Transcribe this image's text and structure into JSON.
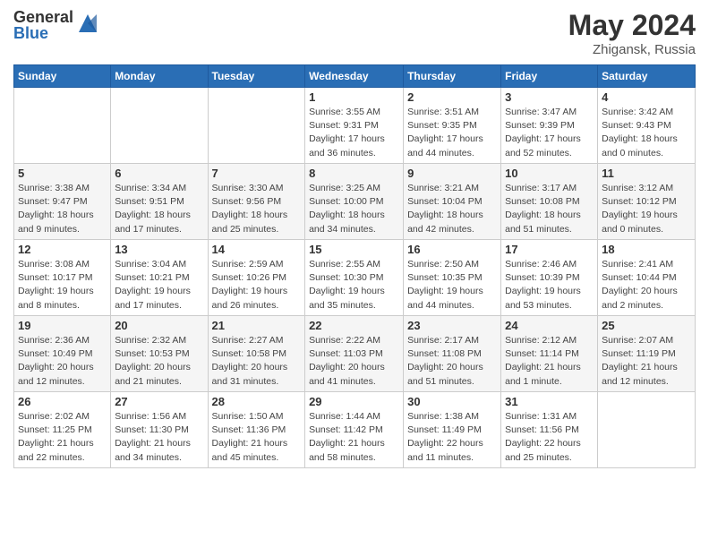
{
  "logo": {
    "general": "General",
    "blue": "Blue"
  },
  "header": {
    "month_year": "May 2024",
    "location": "Zhigansk, Russia"
  },
  "days_of_week": [
    "Sunday",
    "Monday",
    "Tuesday",
    "Wednesday",
    "Thursday",
    "Friday",
    "Saturday"
  ],
  "weeks": [
    [
      {
        "day": "",
        "info": ""
      },
      {
        "day": "",
        "info": ""
      },
      {
        "day": "",
        "info": ""
      },
      {
        "day": "1",
        "info": "Sunrise: 3:55 AM\nSunset: 9:31 PM\nDaylight: 17 hours\nand 36 minutes."
      },
      {
        "day": "2",
        "info": "Sunrise: 3:51 AM\nSunset: 9:35 PM\nDaylight: 17 hours\nand 44 minutes."
      },
      {
        "day": "3",
        "info": "Sunrise: 3:47 AM\nSunset: 9:39 PM\nDaylight: 17 hours\nand 52 minutes."
      },
      {
        "day": "4",
        "info": "Sunrise: 3:42 AM\nSunset: 9:43 PM\nDaylight: 18 hours\nand 0 minutes."
      }
    ],
    [
      {
        "day": "5",
        "info": "Sunrise: 3:38 AM\nSunset: 9:47 PM\nDaylight: 18 hours\nand 9 minutes."
      },
      {
        "day": "6",
        "info": "Sunrise: 3:34 AM\nSunset: 9:51 PM\nDaylight: 18 hours\nand 17 minutes."
      },
      {
        "day": "7",
        "info": "Sunrise: 3:30 AM\nSunset: 9:56 PM\nDaylight: 18 hours\nand 25 minutes."
      },
      {
        "day": "8",
        "info": "Sunrise: 3:25 AM\nSunset: 10:00 PM\nDaylight: 18 hours\nand 34 minutes."
      },
      {
        "day": "9",
        "info": "Sunrise: 3:21 AM\nSunset: 10:04 PM\nDaylight: 18 hours\nand 42 minutes."
      },
      {
        "day": "10",
        "info": "Sunrise: 3:17 AM\nSunset: 10:08 PM\nDaylight: 18 hours\nand 51 minutes."
      },
      {
        "day": "11",
        "info": "Sunrise: 3:12 AM\nSunset: 10:12 PM\nDaylight: 19 hours\nand 0 minutes."
      }
    ],
    [
      {
        "day": "12",
        "info": "Sunrise: 3:08 AM\nSunset: 10:17 PM\nDaylight: 19 hours\nand 8 minutes."
      },
      {
        "day": "13",
        "info": "Sunrise: 3:04 AM\nSunset: 10:21 PM\nDaylight: 19 hours\nand 17 minutes."
      },
      {
        "day": "14",
        "info": "Sunrise: 2:59 AM\nSunset: 10:26 PM\nDaylight: 19 hours\nand 26 minutes."
      },
      {
        "day": "15",
        "info": "Sunrise: 2:55 AM\nSunset: 10:30 PM\nDaylight: 19 hours\nand 35 minutes."
      },
      {
        "day": "16",
        "info": "Sunrise: 2:50 AM\nSunset: 10:35 PM\nDaylight: 19 hours\nand 44 minutes."
      },
      {
        "day": "17",
        "info": "Sunrise: 2:46 AM\nSunset: 10:39 PM\nDaylight: 19 hours\nand 53 minutes."
      },
      {
        "day": "18",
        "info": "Sunrise: 2:41 AM\nSunset: 10:44 PM\nDaylight: 20 hours\nand 2 minutes."
      }
    ],
    [
      {
        "day": "19",
        "info": "Sunrise: 2:36 AM\nSunset: 10:49 PM\nDaylight: 20 hours\nand 12 minutes."
      },
      {
        "day": "20",
        "info": "Sunrise: 2:32 AM\nSunset: 10:53 PM\nDaylight: 20 hours\nand 21 minutes."
      },
      {
        "day": "21",
        "info": "Sunrise: 2:27 AM\nSunset: 10:58 PM\nDaylight: 20 hours\nand 31 minutes."
      },
      {
        "day": "22",
        "info": "Sunrise: 2:22 AM\nSunset: 11:03 PM\nDaylight: 20 hours\nand 41 minutes."
      },
      {
        "day": "23",
        "info": "Sunrise: 2:17 AM\nSunset: 11:08 PM\nDaylight: 20 hours\nand 51 minutes."
      },
      {
        "day": "24",
        "info": "Sunrise: 2:12 AM\nSunset: 11:14 PM\nDaylight: 21 hours\nand 1 minute."
      },
      {
        "day": "25",
        "info": "Sunrise: 2:07 AM\nSunset: 11:19 PM\nDaylight: 21 hours\nand 12 minutes."
      }
    ],
    [
      {
        "day": "26",
        "info": "Sunrise: 2:02 AM\nSunset: 11:25 PM\nDaylight: 21 hours\nand 22 minutes."
      },
      {
        "day": "27",
        "info": "Sunrise: 1:56 AM\nSunset: 11:30 PM\nDaylight: 21 hours\nand 34 minutes."
      },
      {
        "day": "28",
        "info": "Sunrise: 1:50 AM\nSunset: 11:36 PM\nDaylight: 21 hours\nand 45 minutes."
      },
      {
        "day": "29",
        "info": "Sunrise: 1:44 AM\nSunset: 11:42 PM\nDaylight: 21 hours\nand 58 minutes."
      },
      {
        "day": "30",
        "info": "Sunrise: 1:38 AM\nSunset: 11:49 PM\nDaylight: 22 hours\nand 11 minutes."
      },
      {
        "day": "31",
        "info": "Sunrise: 1:31 AM\nSunset: 11:56 PM\nDaylight: 22 hours\nand 25 minutes."
      },
      {
        "day": "",
        "info": ""
      }
    ]
  ]
}
